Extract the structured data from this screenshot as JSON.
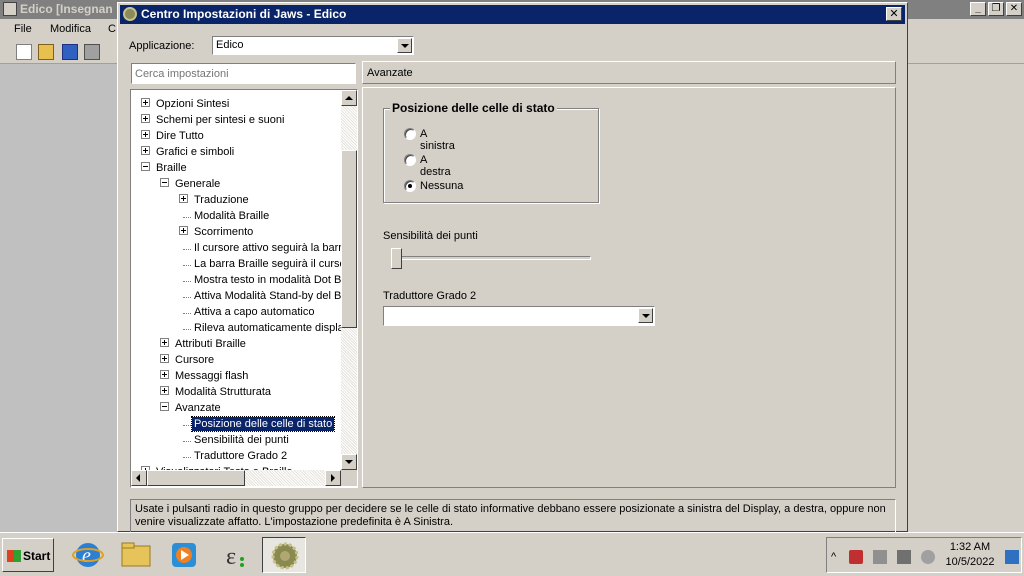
{
  "background_app": {
    "title": "Edico  [Insegnan",
    "menu": [
      "File",
      "Modifica",
      "C"
    ]
  },
  "dialog": {
    "title": "Centro Impostazioni di Jaws - Edico",
    "close_label": "✕",
    "application_label": "Applicazione:",
    "application_value": "Edico",
    "search_placeholder": "Cerca impostazioni",
    "pane_title": "Avanzate",
    "tree": [
      {
        "label": "Opzioni Sintesi",
        "level": 0,
        "expander": "plus"
      },
      {
        "label": "Schemi per sintesi e suoni",
        "level": 0,
        "expander": "plus"
      },
      {
        "label": "Dire Tutto",
        "level": 0,
        "expander": "plus"
      },
      {
        "label": "Grafici e simboli",
        "level": 0,
        "expander": "plus"
      },
      {
        "label": "Braille",
        "level": 0,
        "expander": "minus"
      },
      {
        "label": "Generale",
        "level": 1,
        "expander": "minus"
      },
      {
        "label": "Traduzione",
        "level": 2,
        "expander": "plus"
      },
      {
        "label": "Modalità Braille",
        "level": 2,
        "expander": "none"
      },
      {
        "label": "Scorrimento",
        "level": 2,
        "expander": "plus"
      },
      {
        "label": "Il cursore attivo seguirà la barra",
        "level": 2,
        "expander": "none"
      },
      {
        "label": "La barra Braille seguirà il cursore",
        "level": 2,
        "expander": "none"
      },
      {
        "label": "Mostra testo in modalità Dot Braille",
        "level": 2,
        "expander": "none"
      },
      {
        "label": "Attiva Modalità Stand-by del Braille",
        "level": 2,
        "expander": "none"
      },
      {
        "label": "Attiva a capo automatico",
        "level": 2,
        "expander": "none"
      },
      {
        "label": "Rileva automaticamente display",
        "level": 2,
        "expander": "none"
      },
      {
        "label": "Attributi Braille",
        "level": 1,
        "expander": "plus"
      },
      {
        "label": "Cursore",
        "level": 1,
        "expander": "plus"
      },
      {
        "label": "Messaggi flash",
        "level": 1,
        "expander": "plus"
      },
      {
        "label": "Modalità Strutturata",
        "level": 1,
        "expander": "plus"
      },
      {
        "label": "Avanzate",
        "level": 1,
        "expander": "minus"
      },
      {
        "label": "Posizione delle celle di stato",
        "level": 2,
        "expander": "none",
        "selected": true
      },
      {
        "label": "Sensibilità dei punti",
        "level": 2,
        "expander": "none"
      },
      {
        "label": "Traduttore Grado 2",
        "level": 2,
        "expander": "none"
      },
      {
        "label": "Visualizzatori Testo e Braille",
        "level": 0,
        "expander": "plus"
      }
    ],
    "groupbox_title": "Posizione delle celle di stato",
    "radios": [
      {
        "label": "A sinistra",
        "checked": false
      },
      {
        "label": "A destra",
        "checked": false
      },
      {
        "label": "Nessuna",
        "checked": true
      }
    ],
    "slider_label": "Sensibilità dei punti",
    "slider_value_fraction": 0.0,
    "combo2_label": "Traduttore Grado 2",
    "combo2_value": "",
    "help_text": "Usate i pulsanti radio in questo gruppo per decidere se le celle di stato informative debbano essere posizionate a sinistra del Display, a destra, oppure non venire visualizzate affatto. L'impostazione predefinita è A Sinistra."
  },
  "taskbar": {
    "start_label": "Start",
    "apps": [
      "internet-explorer-icon",
      "folder-icon",
      "media-player-icon",
      "edico-icon",
      "jaws-settings-icon"
    ],
    "time": "1:32 AM",
    "date": "10/5/2022"
  },
  "colors": {
    "title_active": "#0a246a",
    "face": "#d4d0c8"
  }
}
